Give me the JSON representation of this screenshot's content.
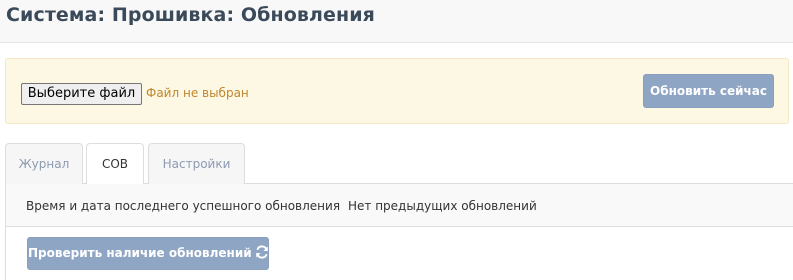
{
  "header": {
    "title": "Система: Прошивка: Обновления"
  },
  "upload": {
    "file_button_label": "Выберите файл",
    "file_status": "Файл не выбран",
    "update_now_label": "Обновить сейчас"
  },
  "tabs": [
    {
      "label": "Журнал",
      "active": false
    },
    {
      "label": "СОВ",
      "active": true
    },
    {
      "label": "Настройки",
      "active": false
    }
  ],
  "panel": {
    "info_label": "Время и дата последнего успешного обновления",
    "info_value": "Нет предыдущих обновлений",
    "check_button_label": "Проверить наличие обновлений",
    "check_button_icon": "refresh-icon"
  },
  "colors": {
    "accent_button": "#8fa5c4",
    "alert_background": "#fcf8e3",
    "file_status_text": "#c0862e",
    "inactive_tab_text": "#8c9bb0"
  }
}
